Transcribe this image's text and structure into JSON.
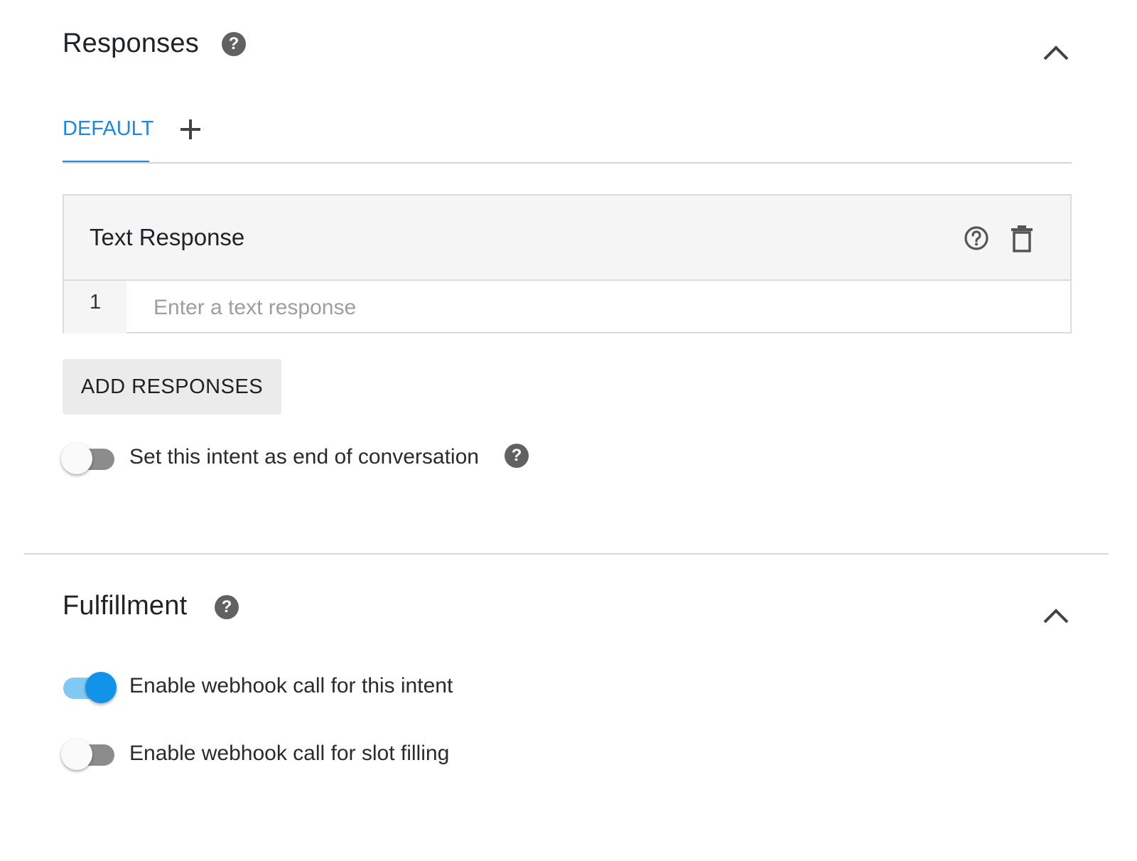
{
  "responses": {
    "title": "Responses",
    "help_icon": "help-circle-filled-icon",
    "collapse_icon": "chevron-up-icon",
    "tabs": [
      {
        "label": "DEFAULT",
        "active": true
      },
      {
        "label": "",
        "icon": "plus-icon"
      }
    ],
    "card": {
      "title": "Text Response",
      "help_icon": "help-circle-outline-icon",
      "delete_icon": "trash-icon",
      "rows": [
        {
          "number": "1",
          "value": "",
          "placeholder": "Enter a text response"
        }
      ]
    },
    "add_button_label": "ADD RESPONSES",
    "end_conversation": {
      "label": "Set this intent as end of conversation",
      "enabled": false,
      "help_icon": "help-circle-filled-icon"
    }
  },
  "fulfillment": {
    "title": "Fulfillment",
    "help_icon": "help-circle-filled-icon",
    "collapse_icon": "chevron-up-icon",
    "toggles": [
      {
        "label": "Enable webhook call for this intent",
        "enabled": true
      },
      {
        "label": "Enable webhook call for slot filling",
        "enabled": false
      }
    ]
  },
  "colors": {
    "accent": "#1e88e5",
    "toggle_on_knob": "#1193ea",
    "toggle_on_track": "#7fcaf5",
    "toggle_off_track": "#8c8c8c",
    "icon_gray": "#616161"
  }
}
